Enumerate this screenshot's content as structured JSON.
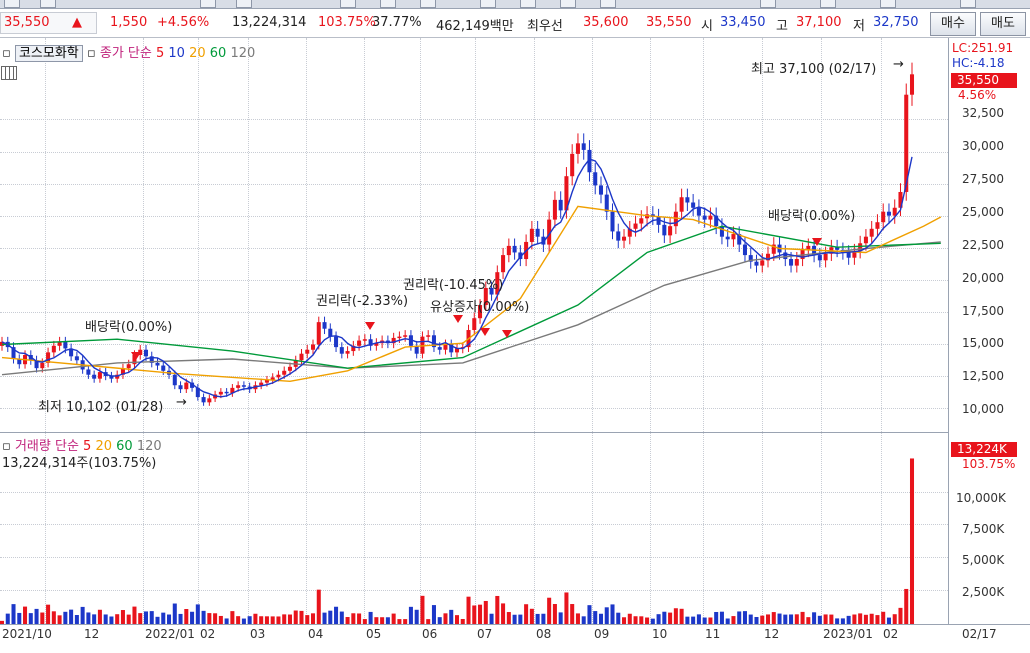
{
  "header": {
    "price": "35,550",
    "up_arrow": "▲",
    "change": "1,550",
    "change_pct": "+4.56%",
    "volume": "13,224,314",
    "vol_ratio": "103.75%",
    "turnover": "37.77%",
    "amount": "462,149백만",
    "order_label": "최우선",
    "ask": "35,600",
    "bid": "35,550",
    "open_label": "시",
    "open": "33,450",
    "high_label": "고",
    "high": "37,100",
    "low_label": "저",
    "low": "32,750",
    "buy_button": "매수",
    "sell_button": "매도"
  },
  "price_legend": {
    "stock_name": "코스모화학",
    "ma_label": "종가 단순",
    "periods": [
      "5",
      "10",
      "20",
      "60",
      "120"
    ],
    "lc": "LC:251.91",
    "hc": "HC:-4.18",
    "current_price": "35,550",
    "current_pct": "4.56%"
  },
  "volume_legend": {
    "label": "거래량",
    "ma_label": "단순",
    "periods": [
      "5",
      "20",
      "60",
      "120"
    ],
    "info": "13,224,314주(103.75%)",
    "current_volume": "13,224K",
    "current_pct": "103.75%"
  },
  "annotations": {
    "high": "최고 37,100 (02/17)",
    "low": "최저 10,102 (01/28)",
    "dividend1": "배당락(0.00%)",
    "rights1": "권리락(-2.33%)",
    "rights2": "권리락(-10.45%)",
    "overlap": "유상증자(0.00%)",
    "dividend2": "배당락(0.00%)"
  },
  "colors": {
    "up": "#e8141c",
    "down": "#1c37c8",
    "ma5": "#e8141c",
    "ma10": "#1c37c8",
    "ma20": "#f0a000",
    "ma60": "#009a3a",
    "ma120": "#7a7a7a"
  },
  "chart_data": {
    "type": "candlestick",
    "x_ticks": [
      "2021/10",
      "12",
      "2022/01",
      "02",
      "03",
      "04",
      "05",
      "06",
      "07",
      "08",
      "09",
      "10",
      "11",
      "12",
      "2023/01",
      "02"
    ],
    "x_right_label": "02/17",
    "price_axis": {
      "ticks": [
        10000,
        12500,
        15000,
        17500,
        20000,
        22500,
        25000,
        27500,
        30000,
        32500
      ],
      "tick_labels": [
        "10,000",
        "12,500",
        "15,000",
        "17,500",
        "20,000",
        "22,500",
        "25,000",
        "27,500",
        "30,000",
        "32,500"
      ],
      "range": [
        8800,
        37400
      ]
    },
    "volume_axis": {
      "ticks": [
        2500,
        5000,
        7500,
        10000
      ],
      "tick_labels": [
        "2,500K",
        "5,000K",
        "7,500K",
        "10,000K"
      ],
      "range": [
        0,
        13900
      ]
    },
    "closes": [
      15200,
      14800,
      13900,
      13500,
      14200,
      13800,
      13200,
      13600,
      14400,
      14900,
      15200,
      14700,
      14100,
      13800,
      13100,
      12700,
      12400,
      12900,
      12600,
      12400,
      12700,
      13200,
      13500,
      14200,
      14600,
      14100,
      13600,
      13400,
      13000,
      12700,
      11900,
      11600,
      12100,
      11700,
      11000,
      10600,
      10900,
      11200,
      11400,
      11300,
      11700,
      11900,
      11800,
      11600,
      11900,
      12100,
      12300,
      12500,
      12700,
      13000,
      13300,
      13800,
      14300,
      14600,
      15000,
      16700,
      16200,
      15600,
      14800,
      14300,
      14500,
      14900,
      15300,
      15400,
      14900,
      15100,
      15300,
      15100,
      15500,
      15600,
      15700,
      14900,
      14300,
      15600,
      15700,
      14800,
      14600,
      15000,
      14400,
      14700,
      14800,
      16100,
      17000,
      18000,
      19300,
      18800,
      20500,
      21800,
      22500,
      22000,
      21500,
      22800,
      23800,
      23200,
      22600,
      24500,
      26000,
      25200,
      27800,
      29500,
      30300,
      29800,
      28100,
      27100,
      26400,
      25100,
      23600,
      22900,
      23200,
      23800,
      24200,
      24600,
      24900,
      24700,
      24100,
      23300,
      24000,
      25100,
      26200,
      25800,
      25400,
      24800,
      24500,
      24800,
      24000,
      23200,
      23000,
      23400,
      22600,
      21800,
      21300,
      21000,
      21400,
      21900,
      22600,
      22000,
      21500,
      21000,
      21500,
      22200,
      22500,
      21800,
      21400,
      21900,
      22400,
      22200,
      22000,
      21600,
      22100,
      22700,
      23200,
      23800,
      24300,
      25100,
      24800,
      25400,
      26600,
      34000,
      35550
    ],
    "ma_values": {
      "ma20": [
        [
          0,
          14000
        ],
        [
          30,
          12800
        ],
        [
          50,
          12200
        ],
        [
          60,
          13000
        ],
        [
          70,
          14800
        ],
        [
          80,
          15100
        ],
        [
          90,
          18500
        ],
        [
          100,
          25500
        ],
        [
          112,
          24800
        ],
        [
          120,
          24500
        ],
        [
          135,
          22300
        ],
        [
          150,
          22000
        ],
        [
          160,
          24000
        ],
        [
          163,
          24700
        ]
      ],
      "ma60": [
        [
          0,
          15000
        ],
        [
          20,
          15400
        ],
        [
          40,
          14500
        ],
        [
          60,
          13200
        ],
        [
          80,
          14000
        ],
        [
          100,
          18000
        ],
        [
          112,
          22000
        ],
        [
          125,
          24000
        ],
        [
          145,
          22400
        ],
        [
          163,
          22700
        ]
      ],
      "ma120": [
        [
          0,
          12700
        ],
        [
          20,
          13600
        ],
        [
          40,
          13900
        ],
        [
          60,
          13200
        ],
        [
          80,
          13600
        ],
        [
          100,
          16500
        ],
        [
          115,
          19500
        ],
        [
          130,
          21400
        ],
        [
          150,
          22300
        ],
        [
          163,
          22800
        ]
      ]
    },
    "volume_units": "K shares"
  }
}
